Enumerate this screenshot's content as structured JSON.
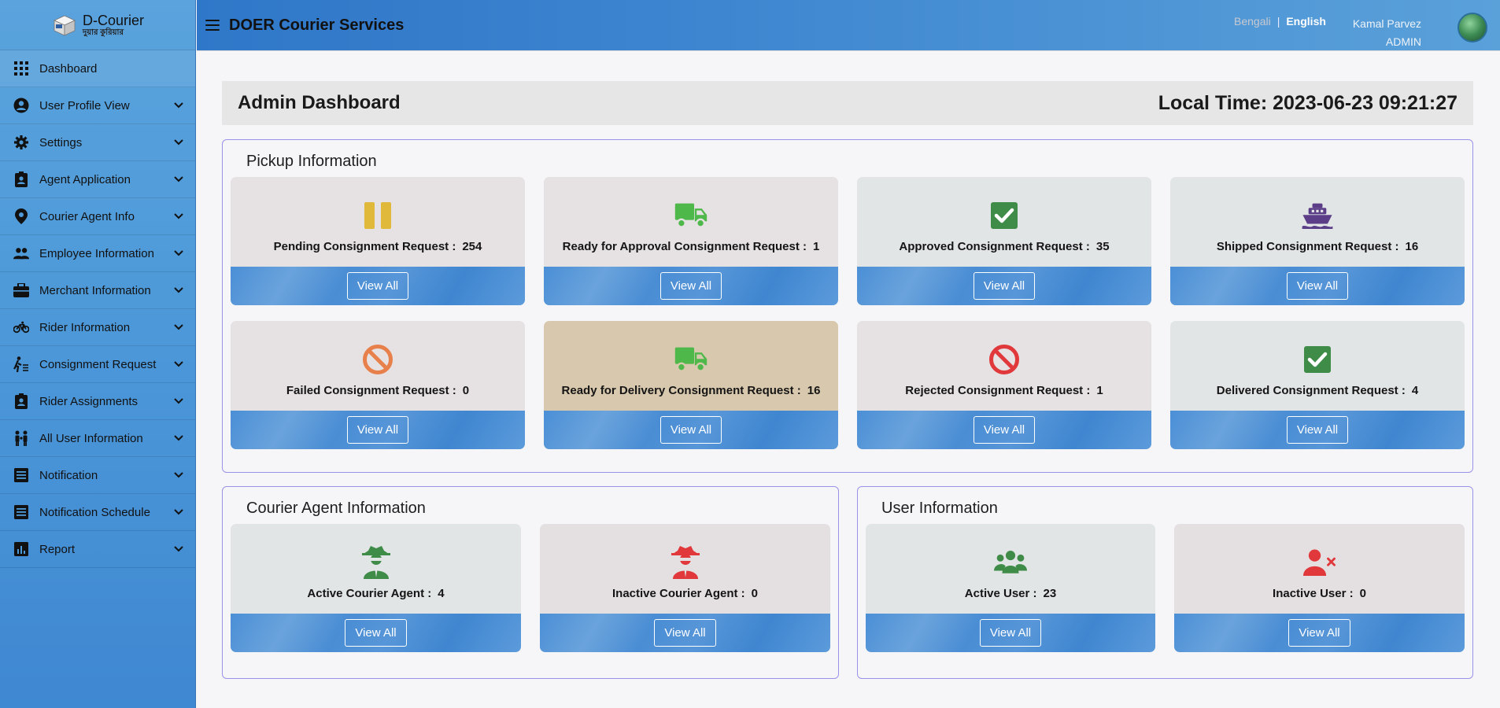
{
  "brand": {
    "name": "D-Courier",
    "sub": "দুয়ার কুরিয়ার"
  },
  "header": {
    "title": "DOER Courier Services",
    "lang_bn": "Bengali",
    "lang_sep": "|",
    "lang_en": "English",
    "user_name": "Kamal Parvez",
    "user_role": "ADMIN"
  },
  "sidebar": {
    "items": [
      {
        "label": "Dashboard"
      },
      {
        "label": "User Profile View"
      },
      {
        "label": "Settings"
      },
      {
        "label": "Agent Application"
      },
      {
        "label": "Courier Agent Info"
      },
      {
        "label": "Employee Information"
      },
      {
        "label": "Merchant Information"
      },
      {
        "label": "Rider Information"
      },
      {
        "label": "Consignment Request"
      },
      {
        "label": "Rider Assignments"
      },
      {
        "label": "All User Information"
      },
      {
        "label": "Notification"
      },
      {
        "label": "Notification Schedule"
      },
      {
        "label": "Report"
      }
    ]
  },
  "dashboard": {
    "title": "Admin Dashboard",
    "local_time": "Local Time: 2023-06-23 09:21:27"
  },
  "pickup": {
    "title": "Pickup Information",
    "cards": [
      {
        "label": "Pending Consignment Request :",
        "count": "254",
        "button": "View All"
      },
      {
        "label": "Ready for Approval Consignment Request :",
        "count": "1",
        "button": "View All"
      },
      {
        "label": "Approved Consignment Request :",
        "count": "35",
        "button": "View All"
      },
      {
        "label": "Shipped Consignment Request :",
        "count": "16",
        "button": "View All"
      },
      {
        "label": "Failed Consignment Request :",
        "count": "0",
        "button": "View All"
      },
      {
        "label": "Ready for Delivery Consignment Request :",
        "count": "16",
        "button": "View All"
      },
      {
        "label": "Rejected Consignment Request :",
        "count": "1",
        "button": "View All"
      },
      {
        "label": "Delivered Consignment Request :",
        "count": "4",
        "button": "View All"
      }
    ]
  },
  "agents": {
    "title": "Courier Agent Information",
    "cards": [
      {
        "label": "Active Courier Agent :",
        "count": "4",
        "button": "View All"
      },
      {
        "label": "Inactive Courier Agent :",
        "count": "0",
        "button": "View All"
      }
    ]
  },
  "users": {
    "title": "User Information",
    "cards": [
      {
        "label": "Active User :",
        "count": "23",
        "button": "View All"
      },
      {
        "label": "Inactive User :",
        "count": "0",
        "button": "View All"
      }
    ]
  },
  "colors": {
    "yellow": "#e0b93a",
    "green": "#4eb84a",
    "darkgreen": "#3f8b48",
    "purple": "#5b3e87",
    "orange": "#e8804b",
    "red": "#e0383b",
    "blue": "#4a8dd4"
  }
}
